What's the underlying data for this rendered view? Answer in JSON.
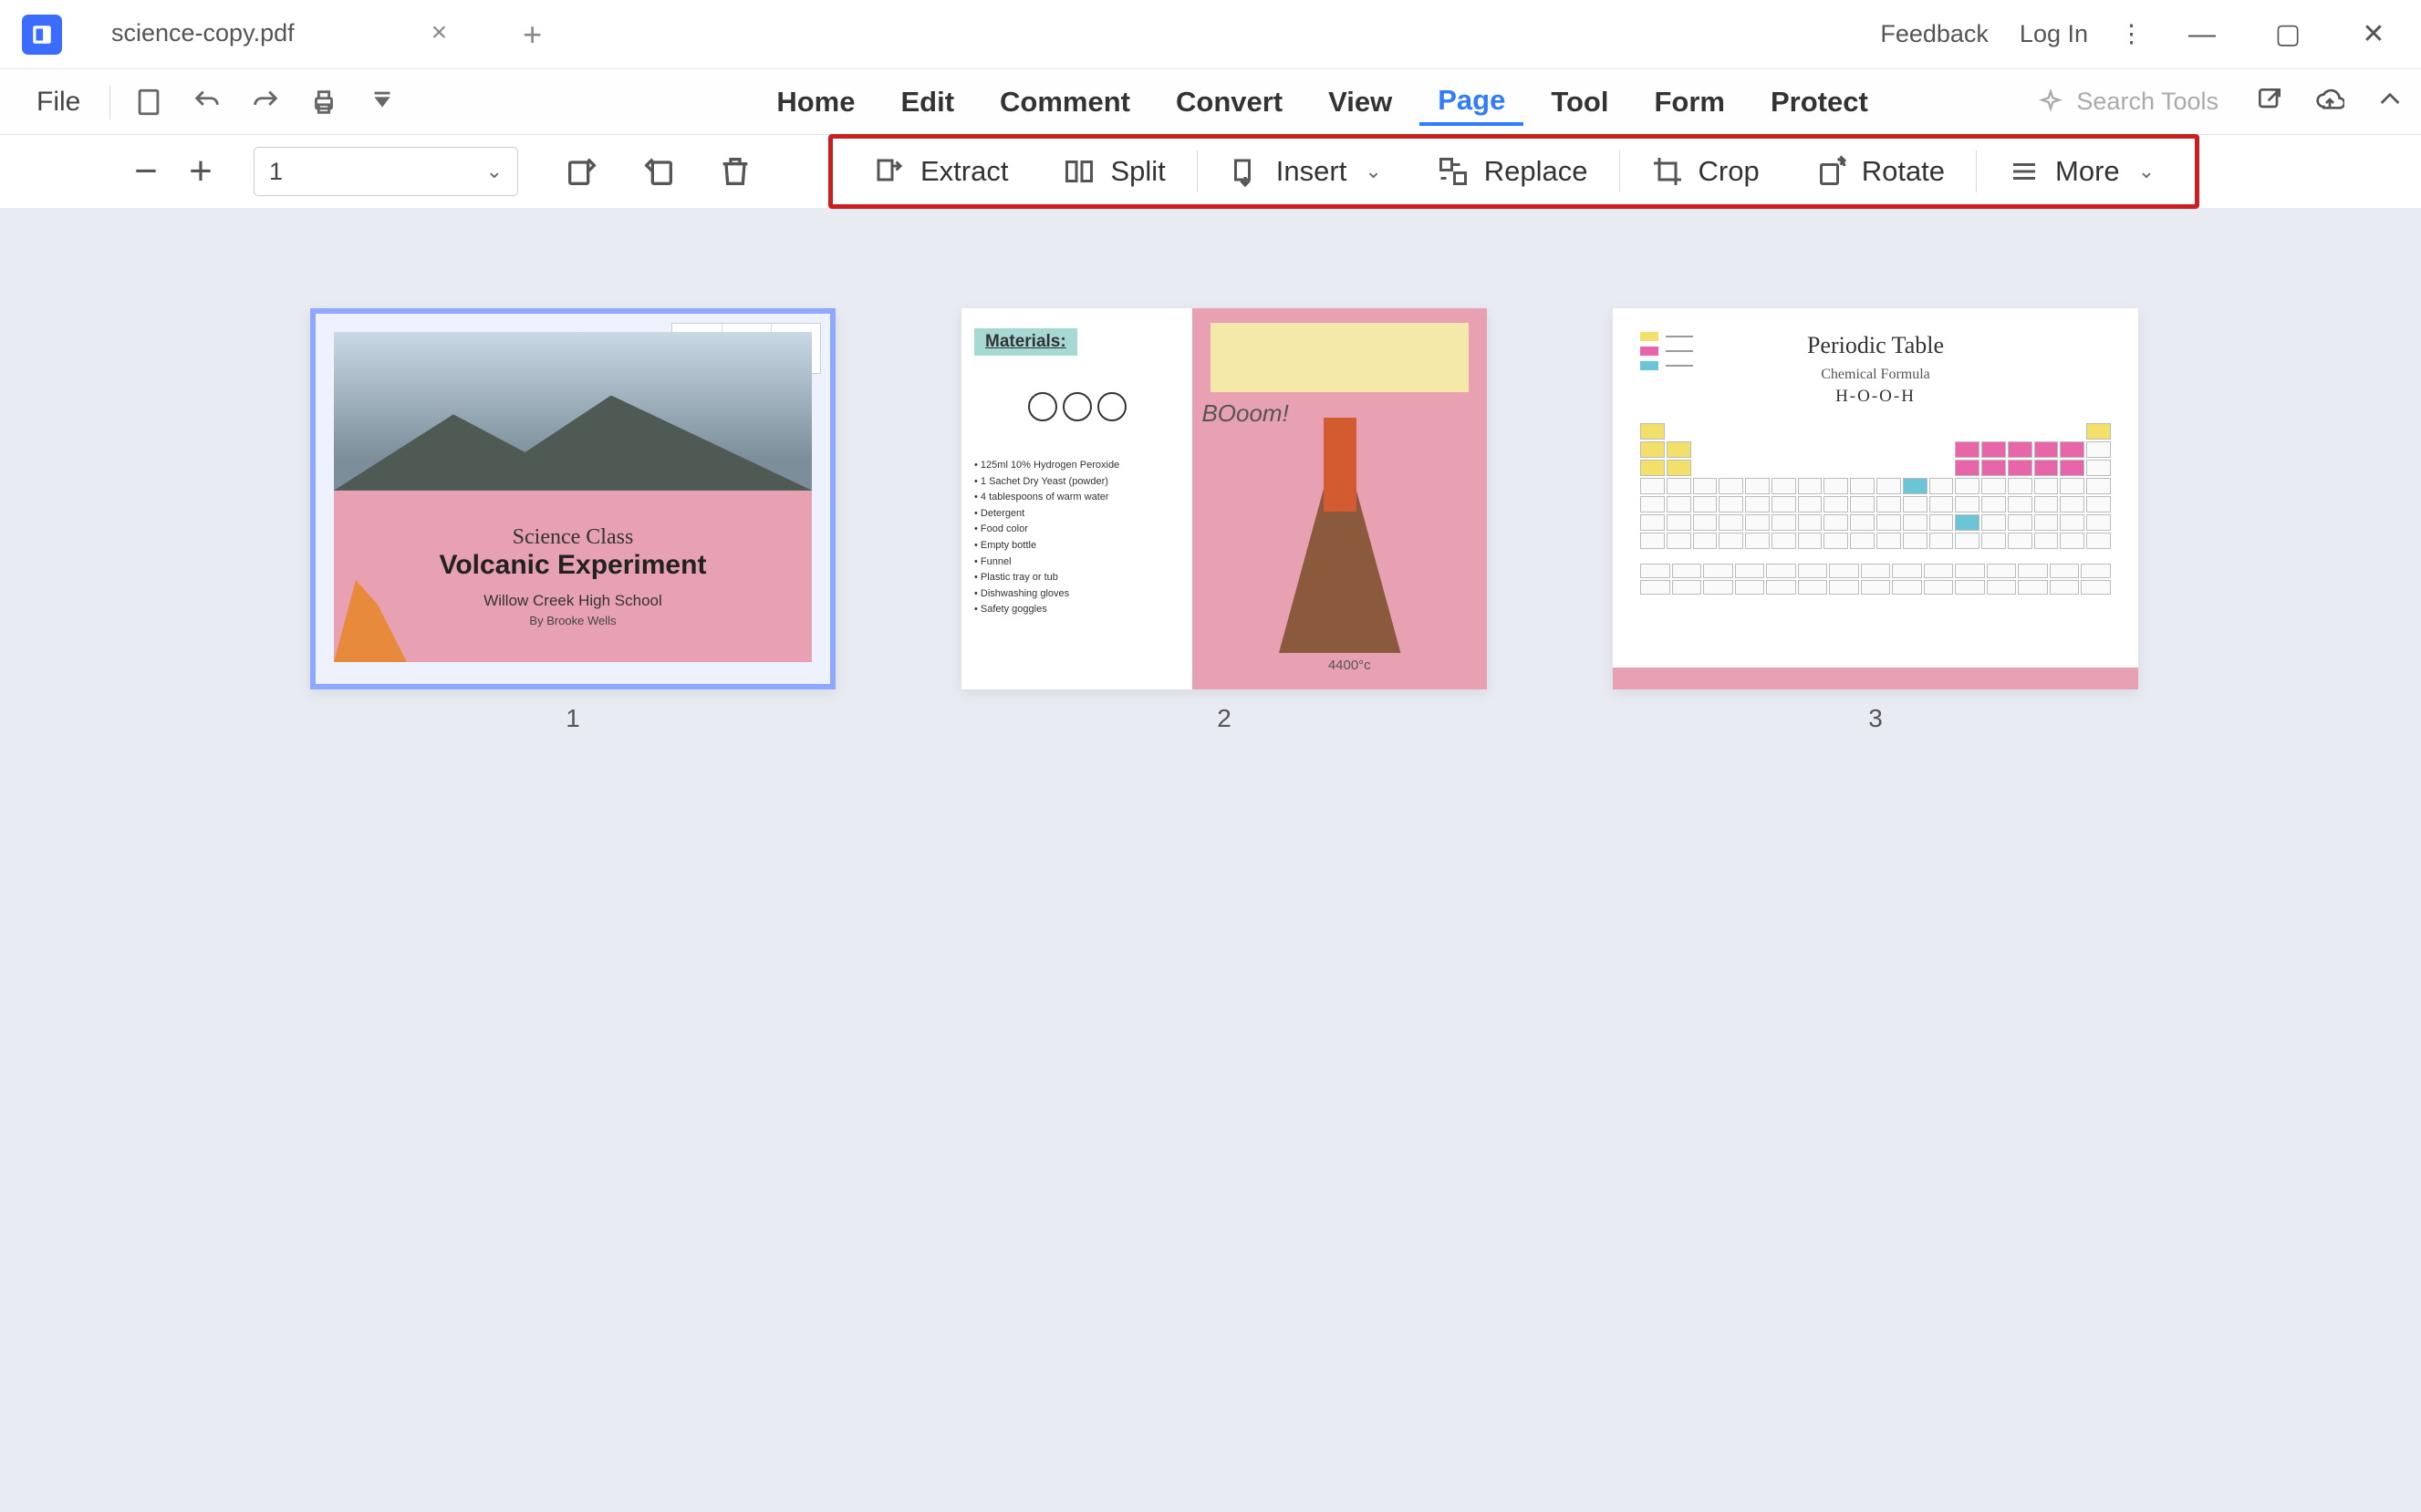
{
  "app": {
    "tab_title": "science-copy.pdf"
  },
  "titlebar_right": {
    "feedback": "Feedback",
    "login": "Log In"
  },
  "menubar": {
    "file": "File",
    "items": [
      "Home",
      "Edit",
      "Comment",
      "Convert",
      "View",
      "Page",
      "Tool",
      "Form",
      "Protect"
    ],
    "active": "Page",
    "search_placeholder": "Search Tools"
  },
  "toolbar": {
    "page_value": "1",
    "actions": {
      "extract": "Extract",
      "split": "Split",
      "insert": "Insert",
      "replace": "Replace",
      "crop": "Crop",
      "rotate": "Rotate",
      "more": "More"
    }
  },
  "thumbs": {
    "p1": {
      "num": "1",
      "title1": "Science Class",
      "title2": "Volcanic Experiment",
      "school": "Willow Creek High School",
      "author": "By Brooke Wells"
    },
    "p2": {
      "num": "2",
      "materials_label": "Materials:",
      "list": [
        "125ml 10% Hydrogen Peroxide",
        "1 Sachet Dry Yeast (powder)",
        "4 tablespoons of warm water",
        "Detergent",
        "Food color",
        "Empty bottle",
        "Funnel",
        "Plastic tray or tub",
        "Dishwashing gloves",
        "Safety goggles"
      ],
      "boom": "BOoom!",
      "temp": "4400°c"
    },
    "p3": {
      "num": "3",
      "title": "Periodic Table",
      "subtitle": "Chemical Formula",
      "formula": "H-O-O-H"
    }
  }
}
